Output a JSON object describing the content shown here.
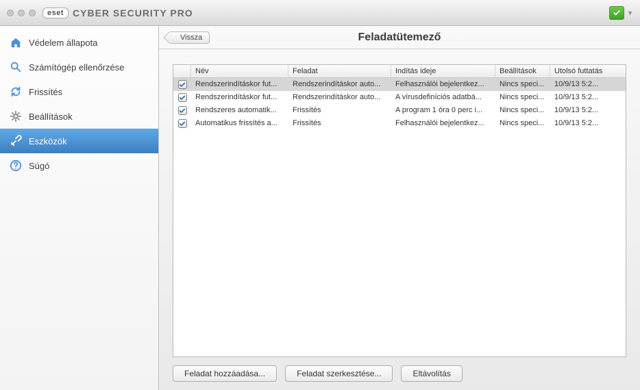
{
  "window": {
    "brand_badge": "eset",
    "brand_title": "CYBER SECURITY PRO"
  },
  "sidebar": {
    "items": [
      {
        "label": "Védelem állapota"
      },
      {
        "label": "Számítógép ellenőrzése"
      },
      {
        "label": "Frissítés"
      },
      {
        "label": "Beállítások"
      },
      {
        "label": "Eszközök"
      },
      {
        "label": "Súgó"
      }
    ],
    "selected_index": 4
  },
  "main": {
    "back_label": "Vissza",
    "title": "Feladatütemező"
  },
  "table": {
    "columns": {
      "name": "Név",
      "task": "Feladat",
      "start": "Indítás ideje",
      "settings": "Beállítások",
      "last_run": "Utolsó futtatás"
    },
    "rows": [
      {
        "checked": true,
        "selected": true,
        "name": "Rendszerindításkor fut...",
        "task": "Rendszerindításkor auto...",
        "start": "Felhasználói bejelentkez...",
        "settings": "Nincs speci...",
        "last_run": "10/9/13 5:2..."
      },
      {
        "checked": true,
        "selected": false,
        "name": "Rendszerindításkor fut...",
        "task": "Rendszerindításkor auto...",
        "start": "A vírusdefiníciós adatbá...",
        "settings": "Nincs speci...",
        "last_run": "10/9/13 5:2..."
      },
      {
        "checked": true,
        "selected": false,
        "name": "Rendszeres automatik...",
        "task": "Frissítés",
        "start": "A program 1 óra 0 perc i...",
        "settings": "Nincs speci...",
        "last_run": "10/9/13 5:2..."
      },
      {
        "checked": true,
        "selected": false,
        "name": "Automatikus frissítés a...",
        "task": "Frissítés",
        "start": "Felhasználói bejelentkez...",
        "settings": "Nincs speci...",
        "last_run": "10/9/13 5:2..."
      }
    ]
  },
  "buttons": {
    "add": "Feladat hozzáadása...",
    "edit": "Feladat szerkesztése...",
    "remove": "Eltávolítás"
  }
}
